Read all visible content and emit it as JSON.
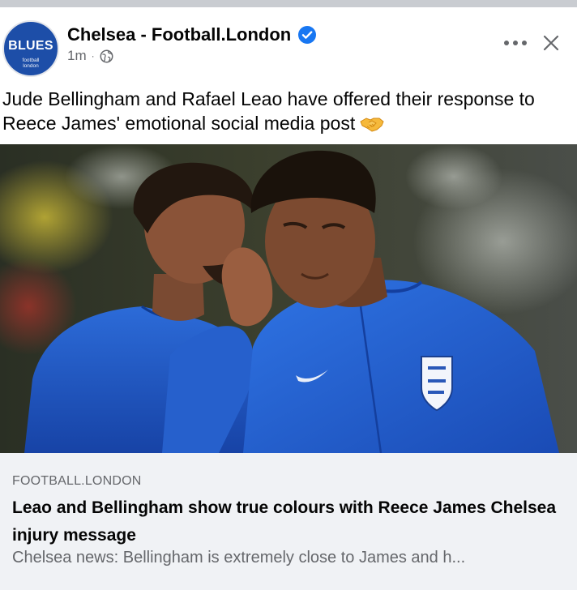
{
  "post": {
    "avatar": {
      "main_text": "BLUES",
      "sub_text": "football\nlondon"
    },
    "page_name": "Chelsea - Football.London",
    "time": "1m",
    "separator": "·",
    "caption": "Jude Bellingham and Rafael Leao have offered their response to Reece James' emotional social media post",
    "icons": {
      "verified": "verified-badge-icon",
      "privacy": "globe-icon",
      "more": "more-options-icon",
      "close": "close-icon",
      "emoji": "handshake-emoji"
    }
  },
  "link_preview": {
    "domain": "FOOTBALL.LONDON",
    "title": "Leao and Bellingham show true colours with Reece James Chelsea injury message",
    "description": "Chelsea news: Bellingham is extremely close to James and h..."
  },
  "colors": {
    "verified_blue": "#1877f2",
    "secondary_text": "#65676b",
    "link_box_bg": "#f0f2f5",
    "avatar_blue": "#1d4ea8"
  }
}
